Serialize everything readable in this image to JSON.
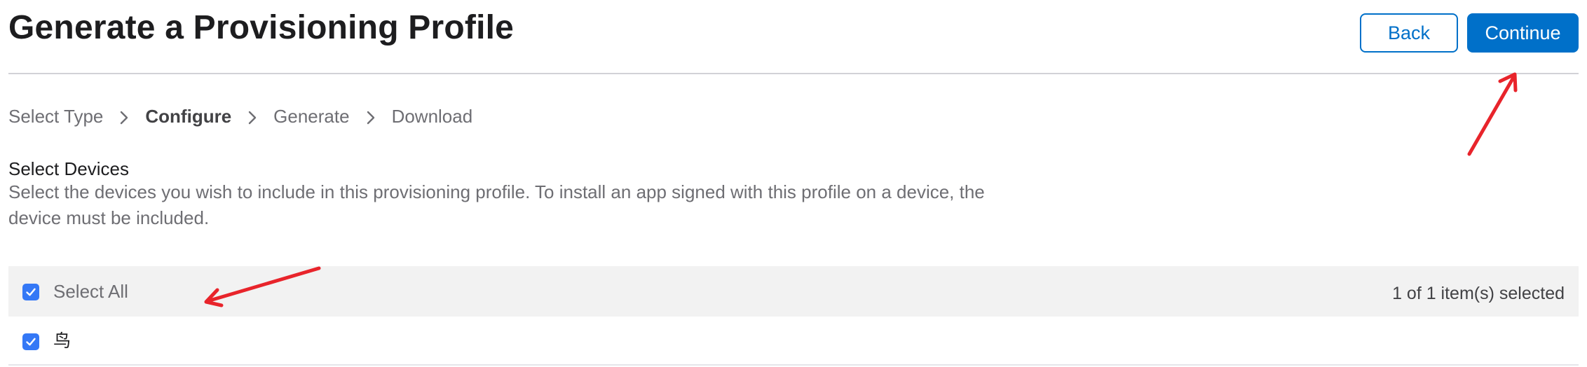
{
  "header": {
    "title": "Generate a Provisioning Profile",
    "back_label": "Back",
    "continue_label": "Continue"
  },
  "breadcrumb": {
    "steps": [
      {
        "label": "Select Type",
        "active": false
      },
      {
        "label": "Configure",
        "active": true
      },
      {
        "label": "Generate",
        "active": false
      },
      {
        "label": "Download",
        "active": false
      }
    ]
  },
  "section": {
    "title": "Select Devices",
    "description": "Select the devices you wish to include in this provisioning profile. To install an app signed with this profile on a device, the device must be included."
  },
  "table": {
    "select_all_label": "Select All",
    "select_all_checked": true,
    "selection_count": "1 of 1 item(s) selected",
    "devices": [
      {
        "name": "鸟",
        "checked": true
      }
    ]
  },
  "icons": {
    "breadcrumb_separator": "chevron-right-icon",
    "checkbox": "checkmark-icon"
  },
  "colors": {
    "accent": "#0070c9",
    "checkbox": "#3478f6",
    "annotation_arrow": "#e8242b"
  }
}
